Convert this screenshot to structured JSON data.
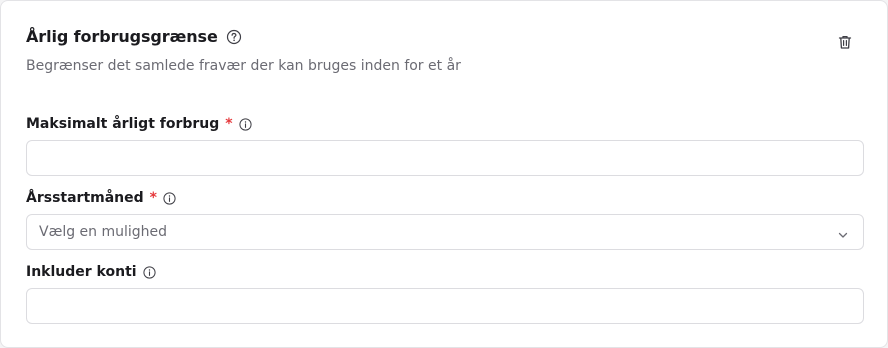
{
  "header": {
    "title": "Årlig forbrugsgrænse",
    "subtitle": "Begrænser det samlede fravær der kan bruges inden for et år",
    "help_icon": "question-circle-icon",
    "delete_icon": "trash-icon"
  },
  "fields": {
    "max_annual": {
      "label": "Maksimalt årligt forbrug",
      "required_mark": "*",
      "info_icon": "info-circle-icon",
      "value": ""
    },
    "start_month": {
      "label": "Årsstartmåned",
      "required_mark": "*",
      "info_icon": "info-circle-icon",
      "placeholder": "Vælg en mulighed",
      "chevron_icon": "chevron-down-icon"
    },
    "include_accounts": {
      "label": "Inkluder konti",
      "info_icon": "info-circle-icon",
      "value": ""
    }
  },
  "colors": {
    "required": "#e5383b",
    "border": "#dcdce0",
    "muted_text": "#6b6b73",
    "text": "#1b1b1f"
  }
}
